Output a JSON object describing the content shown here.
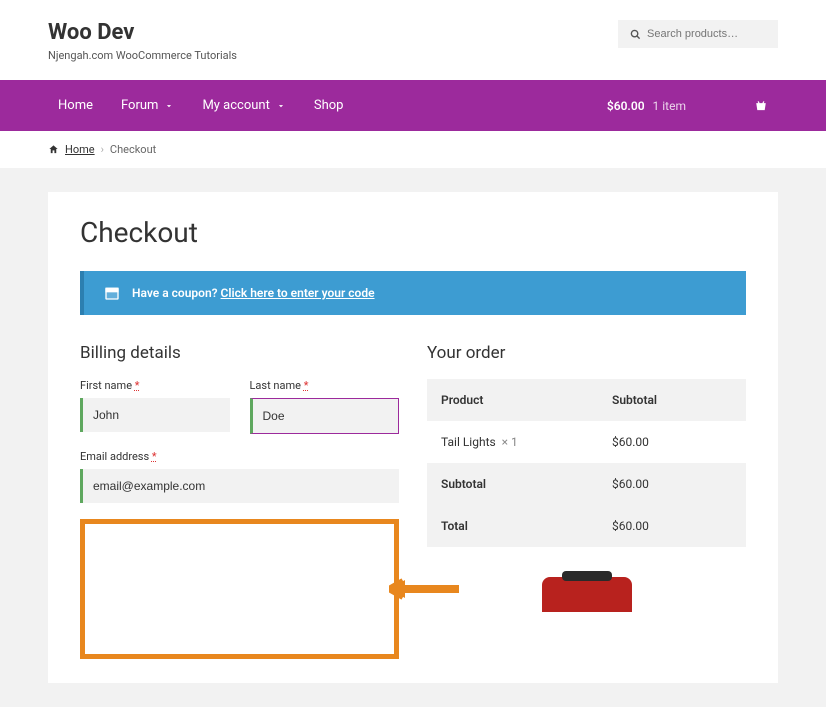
{
  "site": {
    "title": "Woo Dev",
    "tagline": "Njengah.com WooCommerce Tutorials"
  },
  "search": {
    "placeholder": "Search products…"
  },
  "nav": {
    "items": [
      {
        "label": "Home"
      },
      {
        "label": "Forum",
        "has_chevron": true
      },
      {
        "label": "My account",
        "has_chevron": true
      },
      {
        "label": "Shop"
      }
    ],
    "cart": {
      "total": "$60.00",
      "count": "1 item"
    }
  },
  "breadcrumb": {
    "home": "Home",
    "current": "Checkout"
  },
  "page": {
    "title": "Checkout"
  },
  "coupon": {
    "prompt": "Have a coupon?",
    "link": "Click here to enter your code"
  },
  "billing": {
    "heading": "Billing details",
    "first_name_label": "First name",
    "first_name_value": "John",
    "last_name_label": "Last name",
    "last_name_value": "Doe",
    "email_label": "Email address",
    "email_value": "email@example.com"
  },
  "order": {
    "heading": "Your order",
    "product_header": "Product",
    "subtotal_header": "Subtotal",
    "items": [
      {
        "name": "Tail Lights",
        "qty": "× 1",
        "price": "$60.00"
      }
    ],
    "subtotal_label": "Subtotal",
    "subtotal_value": "$60.00",
    "total_label": "Total",
    "total_value": "$60.00"
  }
}
